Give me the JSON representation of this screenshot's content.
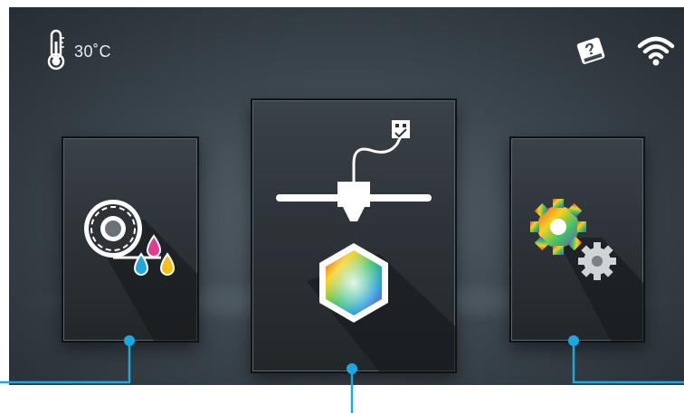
{
  "status_bar": {
    "temperature": "30˚C",
    "icons": {
      "thermometer": "thermometer-icon",
      "help": "help-book-icon",
      "wifi": "wifi-icon"
    }
  },
  "menu": {
    "items": [
      {
        "id": "filament",
        "icon": "filament-spool-icon"
      },
      {
        "id": "print",
        "icon": "printer-usb-icon",
        "selected": true
      },
      {
        "id": "settings",
        "icon": "gears-icon"
      }
    ]
  },
  "colors": {
    "callout": "#19a8e0",
    "background_center": "#5a6670",
    "background_edge": "#262d33"
  }
}
